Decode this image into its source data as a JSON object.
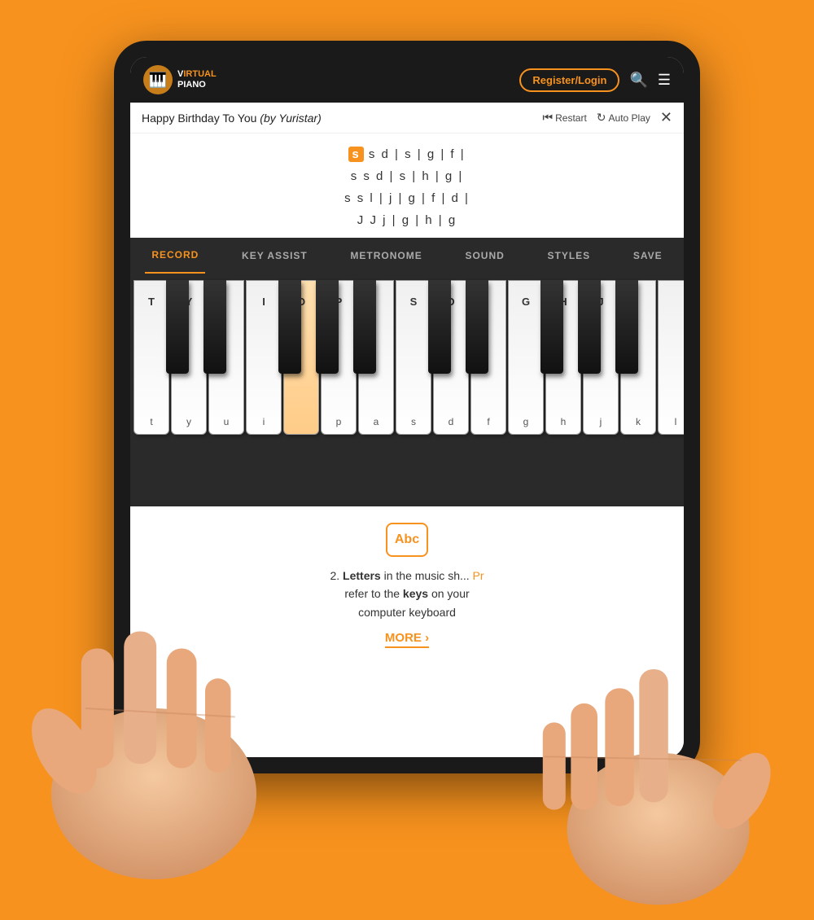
{
  "background": "#F7921E",
  "tablet": {
    "logo": {
      "icon": "🎹",
      "line1": "IRTUAL",
      "line2": "PIANO"
    },
    "header": {
      "register_label": "Register/Login",
      "search_icon": "🔍",
      "menu_icon": "☰"
    },
    "song_bar": {
      "title": "Happy Birthday To You",
      "author": "(by Yuristar)",
      "restart_label": "Restart",
      "autoplay_label": "Auto Play",
      "close": "✕"
    },
    "sheet": {
      "lines": [
        [
          "s",
          "s",
          "d",
          "|",
          "s",
          "|",
          "g",
          "|",
          "f",
          "|"
        ],
        [
          "s",
          "s",
          "d",
          "|",
          "s",
          "|",
          "h",
          "|",
          "g",
          "|"
        ],
        [
          "s",
          "s",
          "l",
          "|",
          "j",
          "|",
          "g",
          "|",
          "f",
          "|",
          "d",
          "|"
        ],
        [
          "J",
          "J",
          "j",
          "|",
          "g",
          "|",
          "h",
          "|",
          "g"
        ]
      ],
      "highlighted": "s"
    },
    "toolbar": {
      "items": [
        {
          "label": "RECORD",
          "active": true
        },
        {
          "label": "KEY ASSIST",
          "active": false
        },
        {
          "label": "METRONOME",
          "active": false
        },
        {
          "label": "SOUND",
          "active": false
        },
        {
          "label": "STYLES",
          "active": false
        },
        {
          "label": "SAVE",
          "active": false
        }
      ]
    },
    "piano": {
      "white_keys": [
        {
          "label_top": "T",
          "label_bottom": "t"
        },
        {
          "label_top": "Y",
          "label_bottom": "y"
        },
        {
          "label_top": "",
          "label_bottom": "u"
        },
        {
          "label_top": "I",
          "label_bottom": "i"
        },
        {
          "label_top": "O",
          "label_bottom": ""
        },
        {
          "label_top": "P",
          "label_bottom": "p"
        },
        {
          "label_top": "",
          "label_bottom": "a"
        },
        {
          "label_top": "S",
          "label_bottom": "s"
        },
        {
          "label_top": "D",
          "label_bottom": "d"
        },
        {
          "label_top": "",
          "label_bottom": "f"
        },
        {
          "label_top": "G",
          "label_bottom": "g"
        },
        {
          "label_top": "H",
          "label_bottom": "h"
        },
        {
          "label_top": "J",
          "label_bottom": "j"
        },
        {
          "label_top": "",
          "label_bottom": "k"
        },
        {
          "label_top": "",
          "label_bottom": "l"
        }
      ]
    },
    "info_section": {
      "abc_label": "Abc",
      "text_part1": "2. ",
      "text_bold1": "Letters",
      "text_part2": " in the music sheet",
      "text_part3": "refer to the ",
      "text_bold2": "keys",
      "text_part4": " on your",
      "text_part5": "computer keyboard",
      "more_label": "MORE ›"
    }
  }
}
